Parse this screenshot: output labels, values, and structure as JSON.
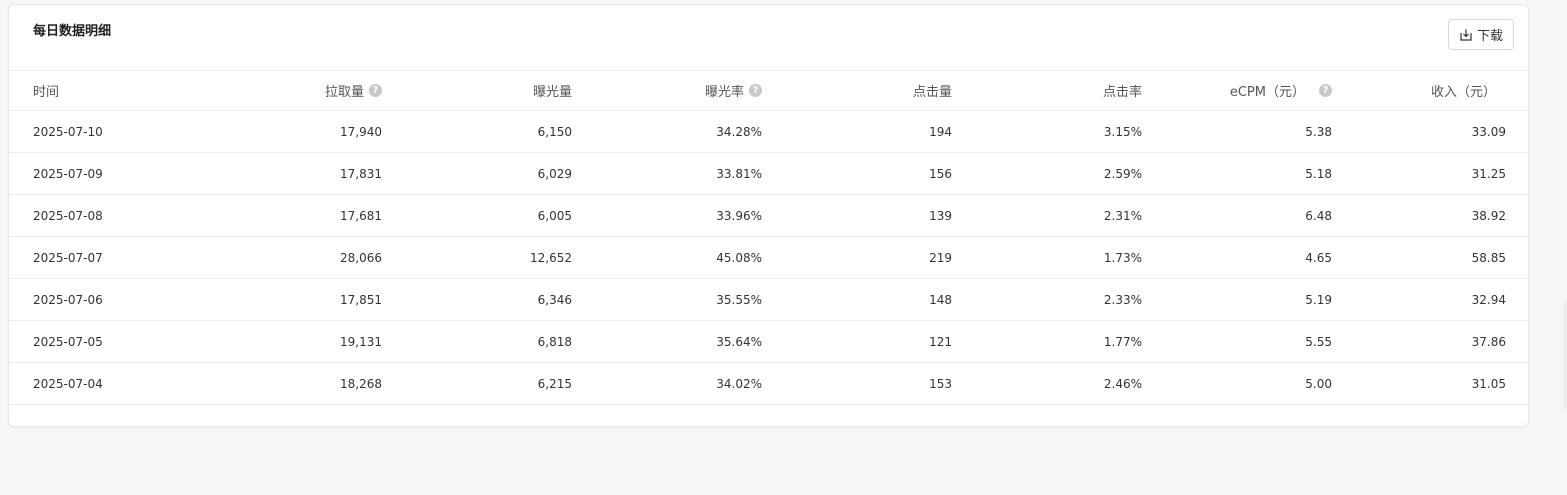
{
  "card": {
    "title": "每日数据明细",
    "download_label": "下载"
  },
  "icons": {
    "download": "download-icon",
    "help": "question-circle-icon"
  },
  "colors": {
    "background": "#f5f6f8",
    "card": "#ffffff",
    "border": "#ececef",
    "help_icon": "#c8c8cc"
  },
  "table": {
    "columns": [
      "时间",
      "拉取量",
      "曝光量",
      "曝光率",
      "点击量",
      "点击率",
      "eCPM（元）",
      "收入（元）"
    ],
    "help_icon_glyph": "?",
    "rows": [
      [
        "2025-07-10",
        "17,940",
        "6,150",
        "34.28%",
        "194",
        "3.15%",
        "5.38",
        "33.09"
      ],
      [
        "2025-07-09",
        "17,831",
        "6,029",
        "33.81%",
        "156",
        "2.59%",
        "5.18",
        "31.25"
      ],
      [
        "2025-07-08",
        "17,681",
        "6,005",
        "33.96%",
        "139",
        "2.31%",
        "6.48",
        "38.92"
      ],
      [
        "2025-07-07",
        "28,066",
        "12,652",
        "45.08%",
        "219",
        "1.73%",
        "4.65",
        "58.85"
      ],
      [
        "2025-07-06",
        "17,851",
        "6,346",
        "35.55%",
        "148",
        "2.33%",
        "5.19",
        "32.94"
      ],
      [
        "2025-07-05",
        "19,131",
        "6,818",
        "35.64%",
        "121",
        "1.77%",
        "5.55",
        "37.86"
      ],
      [
        "2025-07-04",
        "18,268",
        "6,215",
        "34.02%",
        "153",
        "2.46%",
        "5.00",
        "31.05"
      ]
    ]
  }
}
